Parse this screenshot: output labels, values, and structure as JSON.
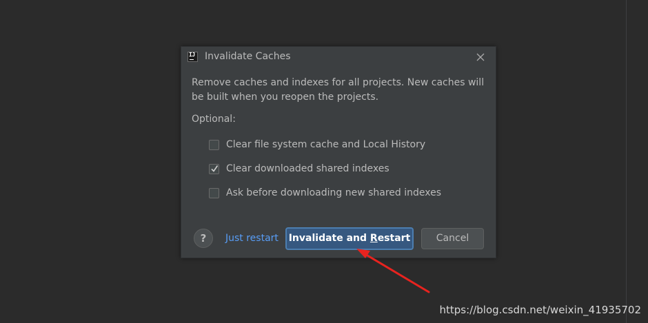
{
  "dialog": {
    "title": "Invalidate Caches",
    "app_icon": "intellij-idea-icon",
    "close_icon": "close-icon",
    "message": "Remove caches and indexes for all projects. New caches will be built when you reopen the projects.",
    "optional_label": "Optional:",
    "options": [
      {
        "label": "Clear file system cache and Local History",
        "checked": false
      },
      {
        "label": "Clear downloaded shared indexes",
        "checked": true
      },
      {
        "label": "Ask before downloading new shared indexes",
        "checked": false
      }
    ],
    "help_label": "?",
    "just_restart_label": "Just restart",
    "primary_label_before": "Invalidate and ",
    "primary_mnemonic": "R",
    "primary_label_after": "estart",
    "cancel_label": "Cancel"
  },
  "annotation": {
    "arrow_color": "#e8231f"
  },
  "watermark": "https://blog.csdn.net/weixin_41935702",
  "colors": {
    "background": "#2b2b2b",
    "dialog_bg": "#3c3f41",
    "primary_button": "#365880",
    "link": "#589df6"
  }
}
